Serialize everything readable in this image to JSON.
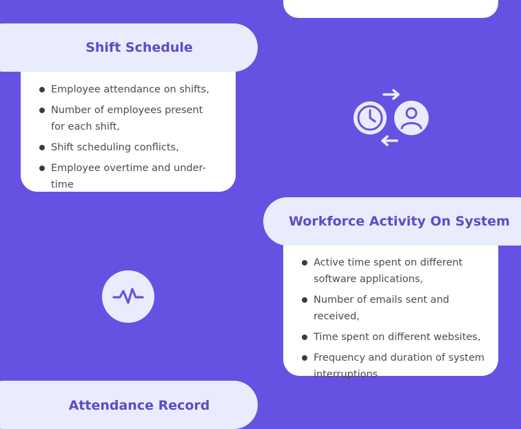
{
  "shift_schedule": {
    "title": "Shift Schedule",
    "items": [
      "Employee attendance on shifts,",
      "Number of employees present for each shift,",
      "Shift scheduling conflicts,",
      "Employee overtime and under-time"
    ]
  },
  "workforce_activity": {
    "title": "Workforce Activity On System",
    "items": [
      "Active time spent on different software applications,",
      "Number of emails sent and received,",
      "Time spent on different websites,",
      "Frequency and duration of system interruptions"
    ]
  },
  "attendance_record": {
    "title": "Attendance Record"
  },
  "icons": {
    "clock_person": "clock-person-swap-icon",
    "activity": "activity-pulse-icon"
  },
  "colors": {
    "background": "#6652e2",
    "pill": "#e9ecfc",
    "title": "#5d4bc6",
    "card": "#ffffff"
  }
}
